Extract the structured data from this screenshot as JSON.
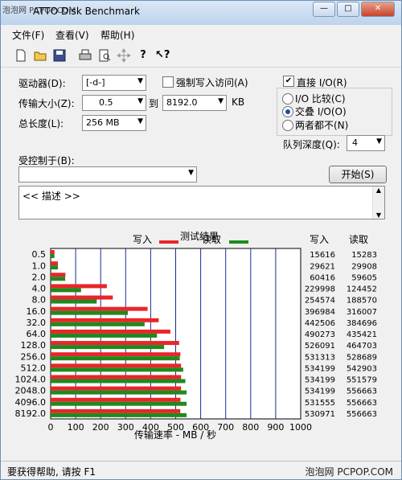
{
  "window": {
    "title": "ATTO Disk Benchmark",
    "watermark": "泡泡网 PCPOP.COM",
    "controls": {
      "minimize": "—",
      "maximize": "□",
      "close": "✕"
    }
  },
  "menu": {
    "items": [
      "文件(F)",
      "查看(V)",
      "帮助(H)"
    ]
  },
  "toolbar": {
    "icons": [
      "new-icon",
      "open-icon",
      "save-icon",
      "print-icon",
      "print-preview-icon",
      "move-icon",
      "help-icon",
      "context-help-icon"
    ]
  },
  "settings": {
    "drive_label": "驱动器(D):",
    "drive_value": "[-d-]",
    "force_write_label": "强制写入访问(A)",
    "direct_io_label": "直接 I/O(R)",
    "transfer_label": "传输大小(Z):",
    "transfer_from": "0.5",
    "to_label": "到",
    "transfer_to": "8192.0",
    "kb_label": "KB",
    "io_compare_label": "I/O 比较(C)",
    "overlapped_label": "交叠 I/O(O)",
    "neither_label": "两者都不(N)",
    "length_label": "总长度(L):",
    "length_value": "256 MB",
    "queue_label": "队列深度(Q):",
    "queue_value": "4",
    "controlled_label": "受控制于(B):",
    "controlled_value": "",
    "start_button": "开始(S)",
    "description": "<< 描述 >>"
  },
  "results": {
    "title": "测试结果",
    "write_label": "写入",
    "read_label": "读取",
    "write_col": "写入",
    "read_col": "读取",
    "write_color": "#e8262a",
    "read_color": "#1e8a1e"
  },
  "chart_data": {
    "type": "bar",
    "orientation": "horizontal",
    "title": "测试结果",
    "xlabel": "传输速率 - MB / 秒",
    "xlim": [
      0,
      1000
    ],
    "xticks": [
      "0",
      "100",
      "200",
      "300",
      "400",
      "500",
      "600",
      "700",
      "800",
      "900",
      "1000"
    ],
    "categories": [
      "0.5",
      "1.0",
      "2.0",
      "4.0",
      "8.0",
      "16.0",
      "32.0",
      "64.0",
      "128.0",
      "256.0",
      "512.0",
      "1024.0",
      "2048.0",
      "4096.0",
      "8192.0"
    ],
    "series": [
      {
        "name": "写入",
        "values": [
          15616,
          29621,
          60416,
          229998,
          254574,
          396984,
          442506,
          490273,
          526091,
          531313,
          534199,
          534199,
          534199,
          531555,
          530971
        ]
      },
      {
        "name": "读取",
        "values": [
          15283,
          29908,
          59605,
          124452,
          188570,
          316007,
          384696,
          435421,
          464703,
          528689,
          542903,
          551579,
          556663,
          556663,
          556663
        ]
      }
    ],
    "write_values_text": [
      "15616",
      "29621",
      "60416",
      "229998",
      "254574",
      "396984",
      "442506",
      "490273",
      "526091",
      "531313",
      "534199",
      "534199",
      "534199",
      "531555",
      "530971"
    ],
    "read_values_text": [
      "15283",
      "29908",
      "59605",
      "124452",
      "188570",
      "316007",
      "384696",
      "435421",
      "464703",
      "528689",
      "542903",
      "551579",
      "556663",
      "556663",
      "556663"
    ]
  },
  "status": {
    "text": "要获得帮助, 请按 F1",
    "watermark": "泡泡网 PCPOP.COM"
  }
}
